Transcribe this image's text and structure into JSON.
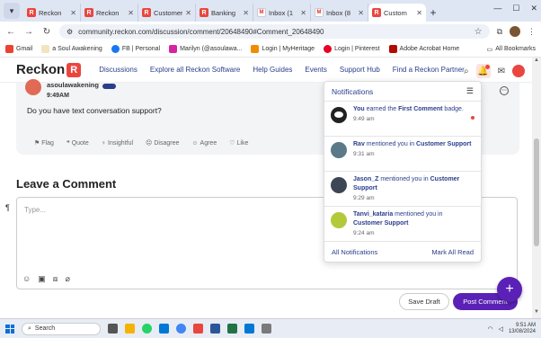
{
  "browser": {
    "tabs": [
      {
        "title": "Reckon",
        "icon": "reckon",
        "active": false
      },
      {
        "title": "Reckon",
        "icon": "reckon",
        "active": false
      },
      {
        "title": "Customer",
        "icon": "reckon",
        "active": false
      },
      {
        "title": "Banking",
        "icon": "reckon",
        "active": false
      },
      {
        "title": "Inbox (1",
        "icon": "gmail",
        "active": false
      },
      {
        "title": "Inbox (8",
        "icon": "gmail",
        "active": false
      },
      {
        "title": "Custom",
        "icon": "reckon",
        "active": true
      }
    ],
    "url": "community.reckon.com/discussion/comment/20648490#Comment_20648490",
    "bookmarks": [
      "Gmail",
      "a Soul Awakening",
      "FB | Personal",
      "Marilyn (@asoulawa...",
      "Login | MyHeritage",
      "Login | Pinterest",
      "Adobe Acrobat Home"
    ],
    "all_bookmarks": "All Bookmarks"
  },
  "site": {
    "logo_text": "Reckon",
    "logo_mark": "R",
    "nav": [
      "Discussions",
      "Explore all Reckon Software",
      "Help Guides",
      "Events",
      "Support Hub",
      "Find a Reckon Partner"
    ]
  },
  "comment": {
    "author": "asoulawakening",
    "time": "9:49AM",
    "text": "Do you have text conversation support?",
    "actions": [
      "Flag",
      "Quote",
      "Insightful",
      "Disagree",
      "Agree",
      "Like"
    ]
  },
  "leave_comment": {
    "title": "Leave a Comment",
    "placeholder": "Type...",
    "save_draft": "Save Draft",
    "post": "Post Comment"
  },
  "notifications": {
    "title": "Notifications",
    "items": [
      {
        "who": "You",
        "pre": " earned the ",
        "bold": "First Comment",
        "post": " badge.",
        "time": "9:49 am",
        "avatar": "badge",
        "unread": true
      },
      {
        "who": "Rav",
        "pre": " mentioned you in ",
        "bold": "Customer Support",
        "post": "",
        "time": "9:31 am",
        "avatar": "rav",
        "unread": false
      },
      {
        "who": "Jason_Z",
        "pre": " mentioned you in ",
        "bold": "Customer Support",
        "post": "",
        "time": "9:29 am",
        "avatar": "jason",
        "unread": false
      },
      {
        "who": "Tanvi_kataria",
        "pre": " mentioned you in ",
        "bold": "Customer Support",
        "post": "",
        "time": "9:24 am",
        "avatar": "tanvi",
        "unread": false
      }
    ],
    "all_label": "All Notifications",
    "mark_read_label": "Mark All Read"
  },
  "taskbar": {
    "search_label": "Search",
    "time": "9:51 AM",
    "date": "13/08/2024"
  },
  "colors": {
    "brand": "#e9463f",
    "accent": "#5b21b6",
    "link": "#2a3e8c"
  }
}
